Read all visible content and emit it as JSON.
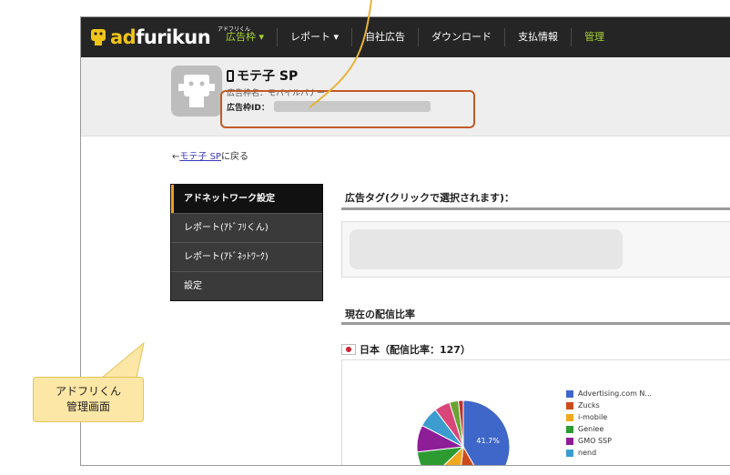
{
  "navbar": {
    "logo_prefix": "ad",
    "logo_text": "furikun",
    "logo_small": "アドフリくん",
    "items": [
      {
        "label": "広告枠 ▾",
        "color": "#a6d133"
      },
      {
        "label": "レポート ▾",
        "color": "#ffffff"
      },
      {
        "label": "自社広告",
        "color": "#ffffff"
      },
      {
        "label": "ダウンロード",
        "color": "#ffffff"
      },
      {
        "label": "支払情報",
        "color": "#ffffff"
      },
      {
        "label": "管理",
        "color": "#a6d133"
      }
    ]
  },
  "header": {
    "app_title": "モテ子 SP",
    "frame_name_label": "広告枠名：モバイルバナー",
    "frame_id_label": "広告枠ID："
  },
  "back": {
    "prefix": "←",
    "link": "モテ子 SP",
    "suffix": "に戻る"
  },
  "sidemenu": {
    "items": [
      {
        "label": "アドネットワーク設定",
        "active": true
      },
      {
        "label": "レポート(ｱﾄﾞﾌﾘくん)",
        "active": false
      },
      {
        "label": "レポート(ｱﾄﾞﾈｯﾄﾜｰｸ)",
        "active": false
      },
      {
        "label": "設定",
        "active": false
      }
    ]
  },
  "main": {
    "tag_title": "広告タグ(クリックで選択されます)：",
    "ratio_title": "現在の配信比率",
    "country_label": "日本（配信比率：127）"
  },
  "chart_data": {
    "type": "pie",
    "slice_label": "41.7%",
    "slices": [
      {
        "name": "Advertising.com N...",
        "value": 41.7,
        "color": "#3f67c9"
      },
      {
        "name": "Zucks",
        "value": 10.2,
        "color": "#cc4b1c"
      },
      {
        "name": "i-mobile",
        "value": 11.0,
        "color": "#f0a91e"
      },
      {
        "name": "Geniee",
        "value": 10.3,
        "color": "#2e9b32"
      },
      {
        "name": "GMO SSP",
        "value": 9.4,
        "color": "#8e1d98"
      },
      {
        "name": "nend",
        "value": 7.1,
        "color": "#3c9cd0"
      },
      {
        "name": "",
        "value": 5.5,
        "color": "#d9477a"
      },
      {
        "name": "",
        "value": 3.1,
        "color": "#6aa334"
      },
      {
        "name": "",
        "value": 1.7,
        "color": "#b8322f"
      }
    ]
  },
  "callout": {
    "line1": "アドフリくん",
    "line2": "管理画面"
  }
}
